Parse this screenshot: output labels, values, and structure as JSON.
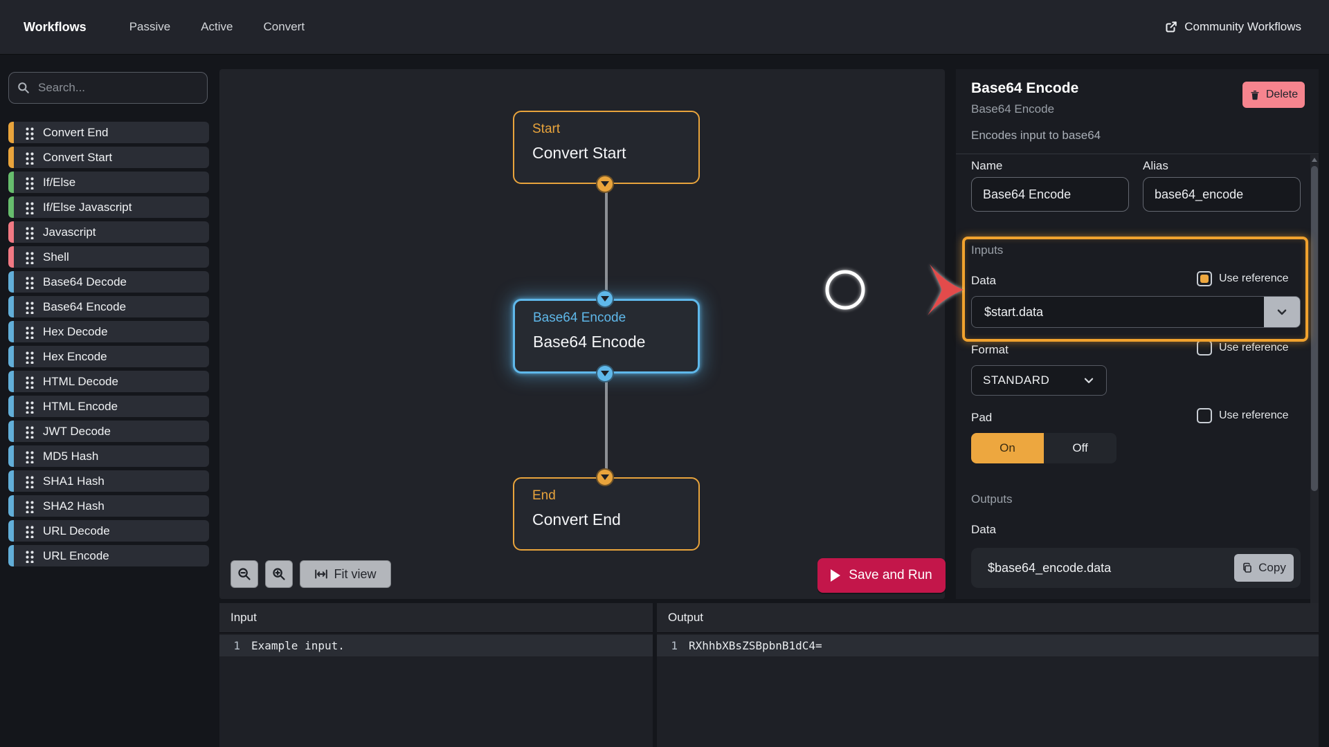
{
  "colors": {
    "orange": "#e9a43c",
    "green": "#67bd6d",
    "red": "#f17983",
    "blue": "#62aed8",
    "node_selected_blue": "#5fb8ea",
    "save_run_crimson": "#c3164a",
    "delete_pink": "#f6848e",
    "annotation_orange": "#f1a22e"
  },
  "nav": {
    "brand": "Workflows",
    "items": [
      "Passive",
      "Active",
      "Convert"
    ],
    "community": "Community Workflows"
  },
  "sidebar": {
    "search_placeholder": "Search...",
    "items": [
      {
        "label": "Convert End",
        "color": "orange"
      },
      {
        "label": "Convert Start",
        "color": "orange"
      },
      {
        "label": "If/Else",
        "color": "green"
      },
      {
        "label": "If/Else Javascript",
        "color": "green"
      },
      {
        "label": "Javascript",
        "color": "red"
      },
      {
        "label": "Shell",
        "color": "red"
      },
      {
        "label": "Base64 Decode",
        "color": "blue"
      },
      {
        "label": "Base64 Encode",
        "color": "blue"
      },
      {
        "label": "Hex Decode",
        "color": "blue"
      },
      {
        "label": "Hex Encode",
        "color": "blue"
      },
      {
        "label": "HTML Decode",
        "color": "blue"
      },
      {
        "label": "HTML Encode",
        "color": "blue"
      },
      {
        "label": "JWT Decode",
        "color": "blue"
      },
      {
        "label": "MD5 Hash",
        "color": "blue"
      },
      {
        "label": "SHA1 Hash",
        "color": "blue"
      },
      {
        "label": "SHA2 Hash",
        "color": "blue"
      },
      {
        "label": "URL Decode",
        "color": "blue"
      },
      {
        "label": "URL Encode",
        "color": "blue"
      }
    ]
  },
  "canvas": {
    "nodes": [
      {
        "kind": "Start",
        "title": "Convert Start"
      },
      {
        "kind": "Base64 Encode",
        "title": "Base64 Encode"
      },
      {
        "kind": "End",
        "title": "Convert End"
      }
    ],
    "fit_view": "Fit view",
    "save_and_run": "Save and Run"
  },
  "inspector": {
    "title": "Base64 Encode",
    "delete_label": "Delete",
    "subtitle": "Base64 Encode",
    "description": "Encodes input to base64",
    "name_label": "Name",
    "name_value": "Base64 Encode",
    "alias_label": "Alias",
    "alias_value": "base64_encode",
    "inputs_label": "Inputs",
    "use_reference_label": "Use reference",
    "data_label": "Data",
    "data_value": "$start.data",
    "data_use_reference_checked": true,
    "format_label": "Format",
    "format_value": "STANDARD",
    "format_use_reference_checked": false,
    "pad_label": "Pad",
    "pad_on": "On",
    "pad_off": "Off",
    "pad_on_selected": true,
    "outputs_label": "Outputs",
    "output_data_label": "Data",
    "output_data_value": "$base64_encode.data",
    "copy_label": "Copy"
  },
  "io": {
    "input": {
      "title": "Input",
      "line_number": "1",
      "content": "Example input."
    },
    "output": {
      "title": "Output",
      "line_number": "1",
      "content": "RXhhbXBsZSBpbnB1dC4="
    }
  }
}
